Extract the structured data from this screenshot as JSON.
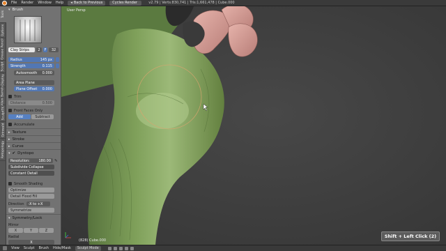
{
  "topbar": {
    "menus": [
      "File",
      "Render",
      "Window",
      "Help"
    ],
    "back_label": "Back to Previous",
    "engine": "Cycles Render",
    "status": "v2.79 | Verts:830,741 | Tris:1,661,478 | Cube.000"
  },
  "tabs": [
    "Tools",
    "Options",
    "Grease Pencil",
    "Sculpt",
    "Display",
    "Alien Barrels",
    "SculptTK",
    "Grinwald",
    "Retopology"
  ],
  "panel": {
    "brush_header": "Brush",
    "brush_name": "Clay Strips",
    "brush_users": "2",
    "brush_num": "32",
    "radius_label": "Radius",
    "radius_value": "145 px",
    "strength_label": "Strength",
    "strength_value": "0.115",
    "autosmooth_label": "Autosmooth",
    "autosmooth_value": "0.000",
    "plane_mode": "Area Plane",
    "plane_offset_label": "Plane Offset",
    "plane_offset_value": "0.000",
    "trim_label": "Trim",
    "distance_label": "Distance",
    "distance_value": "0.500",
    "front_faces_label": "Front Faces Only",
    "add_label": "Add",
    "subtract_label": "Subtract",
    "accumulate_label": "Accumulate",
    "texture_label": "Texture",
    "stroke_label": "Stroke",
    "curve_label": "Curve",
    "dyntopo_label": "Dyntopo",
    "resolution_label": "Resolution:",
    "resolution_value": "180.00",
    "collapse_label": "Subdivide Collapse",
    "detail_label": "Constant Detail",
    "smooth_shading_label": "Smooth Shading",
    "optimize_label": "Optimize",
    "detail_flood_label": "Detail Flood Fill",
    "direction_label": "Direction",
    "direction_value": "-X to +X",
    "symmetrize_label": "Symmetrize",
    "symmetry_header": "Symmetry/Lock",
    "mirror_label": "Mirror",
    "axis_x": "X",
    "axis_y": "Y",
    "axis_z": "Z",
    "radial_label": "Radial"
  },
  "viewport": {
    "title": "User Persp",
    "object_label": "(828) Cube.000",
    "hint": "Shift + Left Click (2)"
  },
  "bottombar": {
    "menus": [
      "View",
      "Sculpt",
      "Brush",
      "Hide/Mask"
    ],
    "mode": "Sculpt Mode"
  },
  "colors": {
    "brush_active": "#5277b3",
    "model_green": "#7fa05a",
    "model_pink": "#d39a94",
    "brush_circle": "#d6a56f"
  }
}
